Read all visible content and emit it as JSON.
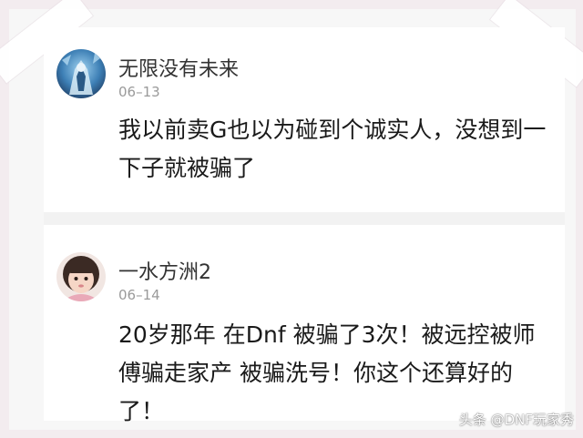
{
  "comments": [
    {
      "username": "无限没有未来",
      "date": "06–13",
      "text": "我以前卖G也以为碰到个诚实人，没想到一下子就被骗了",
      "avatar_icon": "game-character-avatar"
    },
    {
      "username": "一水方洲2",
      "date": "06–14",
      "text": "20岁那年 在Dnf 被骗了3次！被远控被师傅骗走家产 被骗洗号！你这个还算好的了！",
      "avatar_icon": "child-portrait-avatar"
    }
  ],
  "watermark": "头条 @DNF玩家秀",
  "colors": {
    "background": "#f3ecef",
    "card": "#ffffff",
    "divider": "#f2f2f2",
    "text": "#1a1a1a",
    "username": "#333333",
    "date": "#9a9a9a"
  }
}
